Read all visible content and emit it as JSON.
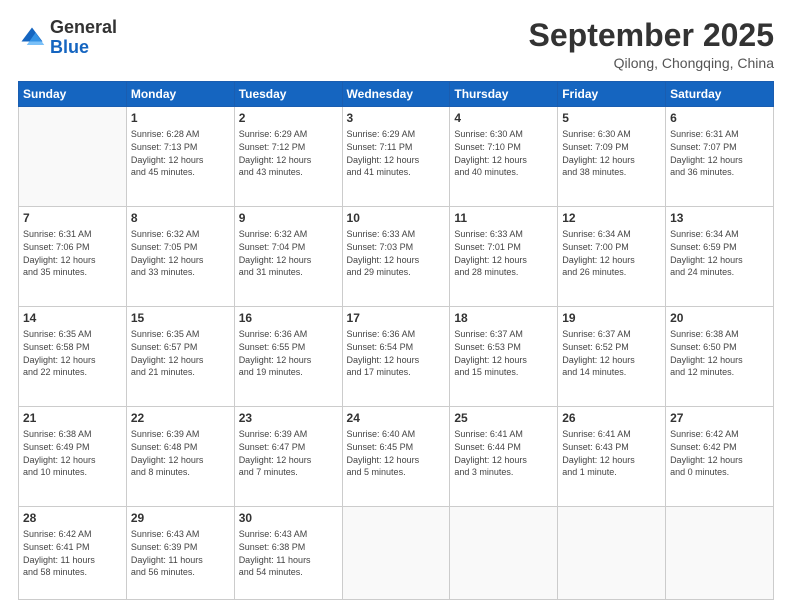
{
  "logo": {
    "general": "General",
    "blue": "Blue"
  },
  "header": {
    "month": "September 2025",
    "location": "Qilong, Chongqing, China"
  },
  "weekdays": [
    "Sunday",
    "Monday",
    "Tuesday",
    "Wednesday",
    "Thursday",
    "Friday",
    "Saturday"
  ],
  "weeks": [
    [
      {
        "num": "",
        "info": ""
      },
      {
        "num": "1",
        "info": "Sunrise: 6:28 AM\nSunset: 7:13 PM\nDaylight: 12 hours\nand 45 minutes."
      },
      {
        "num": "2",
        "info": "Sunrise: 6:29 AM\nSunset: 7:12 PM\nDaylight: 12 hours\nand 43 minutes."
      },
      {
        "num": "3",
        "info": "Sunrise: 6:29 AM\nSunset: 7:11 PM\nDaylight: 12 hours\nand 41 minutes."
      },
      {
        "num": "4",
        "info": "Sunrise: 6:30 AM\nSunset: 7:10 PM\nDaylight: 12 hours\nand 40 minutes."
      },
      {
        "num": "5",
        "info": "Sunrise: 6:30 AM\nSunset: 7:09 PM\nDaylight: 12 hours\nand 38 minutes."
      },
      {
        "num": "6",
        "info": "Sunrise: 6:31 AM\nSunset: 7:07 PM\nDaylight: 12 hours\nand 36 minutes."
      }
    ],
    [
      {
        "num": "7",
        "info": "Sunrise: 6:31 AM\nSunset: 7:06 PM\nDaylight: 12 hours\nand 35 minutes."
      },
      {
        "num": "8",
        "info": "Sunrise: 6:32 AM\nSunset: 7:05 PM\nDaylight: 12 hours\nand 33 minutes."
      },
      {
        "num": "9",
        "info": "Sunrise: 6:32 AM\nSunset: 7:04 PM\nDaylight: 12 hours\nand 31 minutes."
      },
      {
        "num": "10",
        "info": "Sunrise: 6:33 AM\nSunset: 7:03 PM\nDaylight: 12 hours\nand 29 minutes."
      },
      {
        "num": "11",
        "info": "Sunrise: 6:33 AM\nSunset: 7:01 PM\nDaylight: 12 hours\nand 28 minutes."
      },
      {
        "num": "12",
        "info": "Sunrise: 6:34 AM\nSunset: 7:00 PM\nDaylight: 12 hours\nand 26 minutes."
      },
      {
        "num": "13",
        "info": "Sunrise: 6:34 AM\nSunset: 6:59 PM\nDaylight: 12 hours\nand 24 minutes."
      }
    ],
    [
      {
        "num": "14",
        "info": "Sunrise: 6:35 AM\nSunset: 6:58 PM\nDaylight: 12 hours\nand 22 minutes."
      },
      {
        "num": "15",
        "info": "Sunrise: 6:35 AM\nSunset: 6:57 PM\nDaylight: 12 hours\nand 21 minutes."
      },
      {
        "num": "16",
        "info": "Sunrise: 6:36 AM\nSunset: 6:55 PM\nDaylight: 12 hours\nand 19 minutes."
      },
      {
        "num": "17",
        "info": "Sunrise: 6:36 AM\nSunset: 6:54 PM\nDaylight: 12 hours\nand 17 minutes."
      },
      {
        "num": "18",
        "info": "Sunrise: 6:37 AM\nSunset: 6:53 PM\nDaylight: 12 hours\nand 15 minutes."
      },
      {
        "num": "19",
        "info": "Sunrise: 6:37 AM\nSunset: 6:52 PM\nDaylight: 12 hours\nand 14 minutes."
      },
      {
        "num": "20",
        "info": "Sunrise: 6:38 AM\nSunset: 6:50 PM\nDaylight: 12 hours\nand 12 minutes."
      }
    ],
    [
      {
        "num": "21",
        "info": "Sunrise: 6:38 AM\nSunset: 6:49 PM\nDaylight: 12 hours\nand 10 minutes."
      },
      {
        "num": "22",
        "info": "Sunrise: 6:39 AM\nSunset: 6:48 PM\nDaylight: 12 hours\nand 8 minutes."
      },
      {
        "num": "23",
        "info": "Sunrise: 6:39 AM\nSunset: 6:47 PM\nDaylight: 12 hours\nand 7 minutes."
      },
      {
        "num": "24",
        "info": "Sunrise: 6:40 AM\nSunset: 6:45 PM\nDaylight: 12 hours\nand 5 minutes."
      },
      {
        "num": "25",
        "info": "Sunrise: 6:41 AM\nSunset: 6:44 PM\nDaylight: 12 hours\nand 3 minutes."
      },
      {
        "num": "26",
        "info": "Sunrise: 6:41 AM\nSunset: 6:43 PM\nDaylight: 12 hours\nand 1 minute."
      },
      {
        "num": "27",
        "info": "Sunrise: 6:42 AM\nSunset: 6:42 PM\nDaylight: 12 hours\nand 0 minutes."
      }
    ],
    [
      {
        "num": "28",
        "info": "Sunrise: 6:42 AM\nSunset: 6:41 PM\nDaylight: 11 hours\nand 58 minutes."
      },
      {
        "num": "29",
        "info": "Sunrise: 6:43 AM\nSunset: 6:39 PM\nDaylight: 11 hours\nand 56 minutes."
      },
      {
        "num": "30",
        "info": "Sunrise: 6:43 AM\nSunset: 6:38 PM\nDaylight: 11 hours\nand 54 minutes."
      },
      {
        "num": "",
        "info": ""
      },
      {
        "num": "",
        "info": ""
      },
      {
        "num": "",
        "info": ""
      },
      {
        "num": "",
        "info": ""
      }
    ]
  ]
}
